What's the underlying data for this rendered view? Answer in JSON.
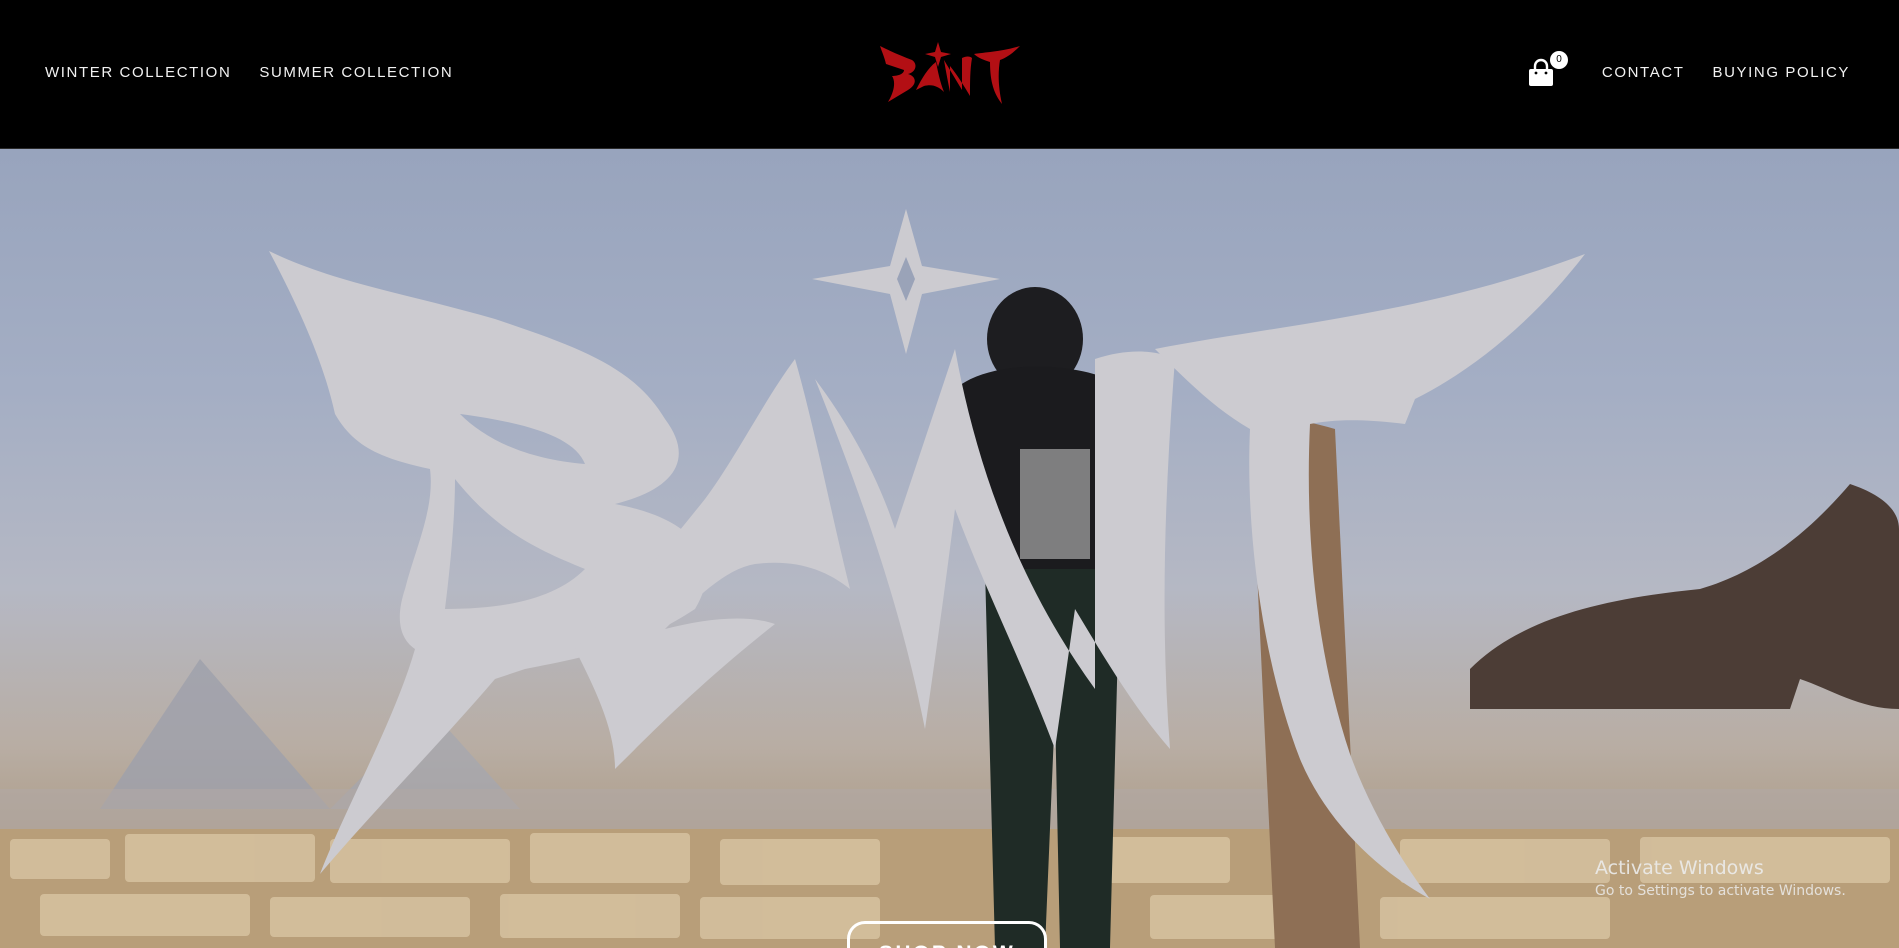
{
  "header": {
    "nav_left": [
      {
        "label": "WINTER COLLECTION"
      },
      {
        "label": "SUMMER COLLECTION"
      }
    ],
    "logo": {
      "text": "SAINT",
      "color": "#b30f14"
    },
    "cart": {
      "icon": "shopping-bag-icon",
      "count": "0"
    },
    "nav_right": [
      {
        "label": "CONTACT"
      },
      {
        "label": "BUYING POLICY"
      }
    ]
  },
  "hero": {
    "wordmark": {
      "text": "SAINT",
      "color": "#cccbd0"
    },
    "cta_label": "SHOP NOW"
  },
  "os_watermark": {
    "title": "Activate Windows",
    "subtitle": "Go to Settings to activate Windows."
  },
  "colors": {
    "header_bg": "#000000",
    "nav_text": "#f2f2f2",
    "brand_red": "#b30f14"
  }
}
